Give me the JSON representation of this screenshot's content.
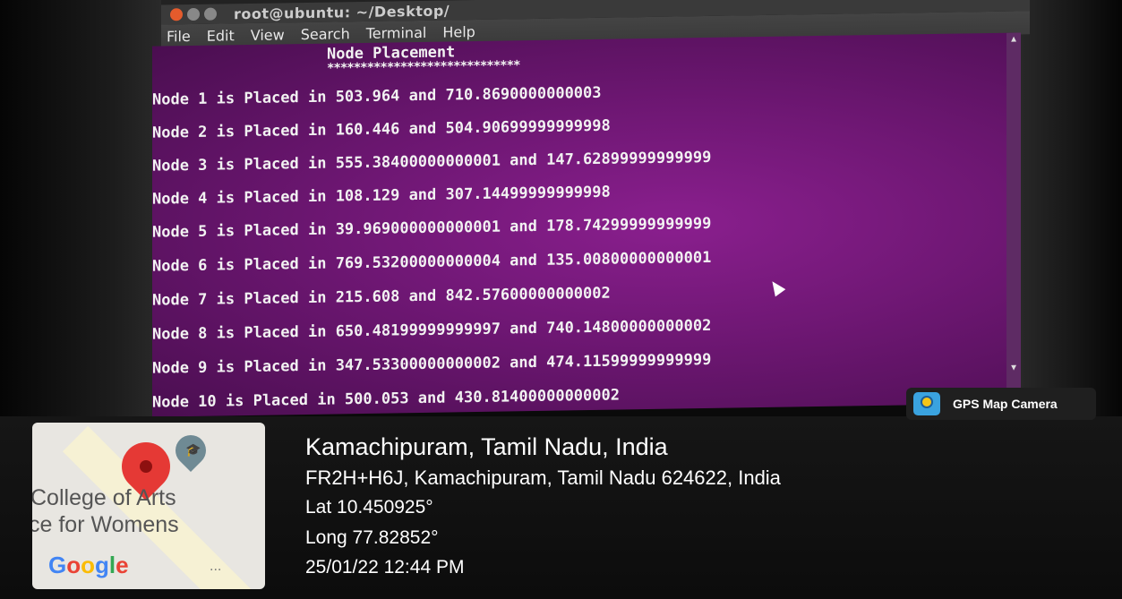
{
  "terminal": {
    "title": "root@ubuntu: ~/Desktop/",
    "menu": [
      "File",
      "Edit",
      "View",
      "Search",
      "Terminal",
      "Help"
    ],
    "heading": "Node Placement",
    "separator": "*****************************",
    "lines": [
      "Node 1 is Placed in 503.964 and 710.8690000000003",
      "Node 2 is Placed in 160.446 and 504.90699999999998",
      "Node 3 is Placed in 555.38400000000001 and 147.62899999999999",
      "Node 4 is Placed in 108.129 and 307.14499999999998",
      "Node 5 is Placed in 39.969000000000001 and 178.74299999999999",
      "Node 6 is Placed in 769.53200000000004 and 135.00800000000001",
      "Node 7 is Placed in 215.608 and 842.57600000000002",
      "Node 8 is Placed in 650.48199999999997 and 740.14800000000002",
      "Node 9 is Placed in 347.53300000000002 and 474.11599999999999",
      "Node 10 is Placed in 500.053 and 430.81400000000002"
    ]
  },
  "gps_badge": {
    "label": "GPS Map Camera"
  },
  "map": {
    "place_line1": "College of Arts",
    "place_line2": "ce for Womens",
    "brand": "Google",
    "dots": "..."
  },
  "location": {
    "place": "Kamachipuram, Tamil Nadu, India",
    "address": "FR2H+H6J, Kamachipuram, Tamil Nadu 624622, India",
    "lat": "Lat 10.450925°",
    "long": "Long 77.82852°",
    "datetime": "25/01/22 12:44 PM"
  }
}
